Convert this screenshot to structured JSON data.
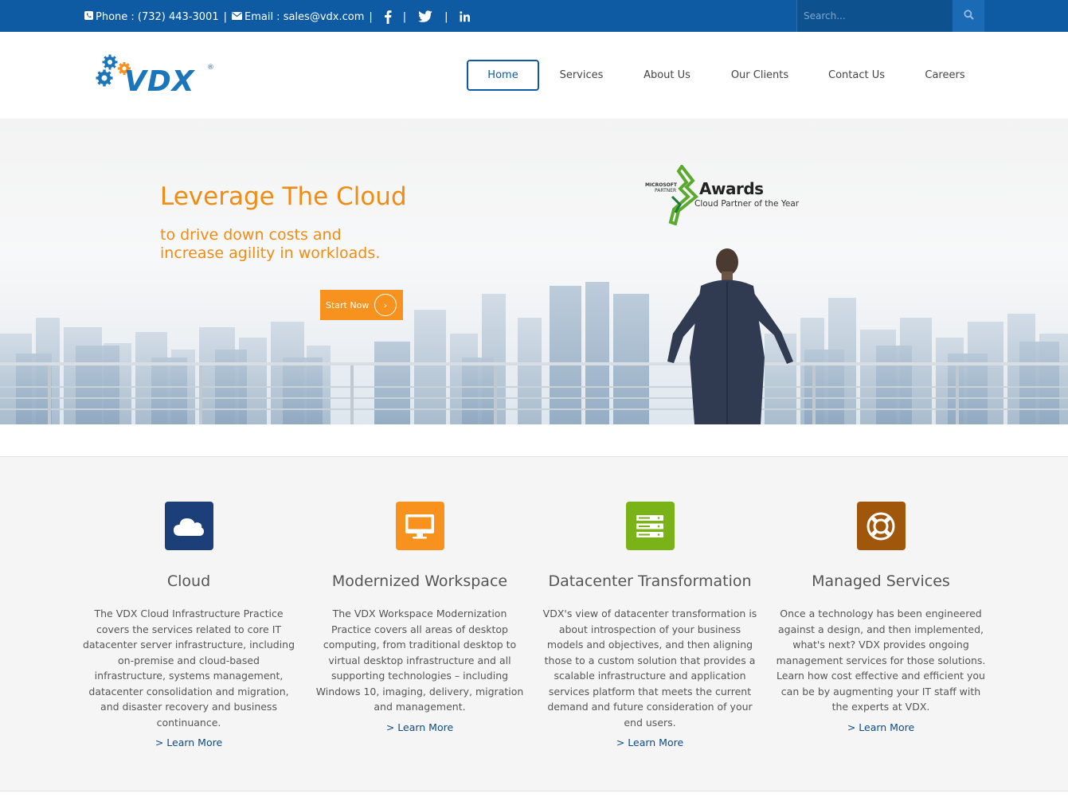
{
  "topbar": {
    "phone_label": "Phone : (732) 443-3001",
    "email_label": "Email : sales@vdx.com",
    "separator": "|",
    "search_placeholder": "Search...",
    "bg_color": "#0e5ba3"
  },
  "brand": {
    "name": "VDX",
    "registered": "®"
  },
  "nav": {
    "items": [
      {
        "label": "Home",
        "active": true
      },
      {
        "label": "Services"
      },
      {
        "label": "About Us"
      },
      {
        "label": "Our Clients"
      },
      {
        "label": "Contact Us"
      },
      {
        "label": "Careers"
      }
    ]
  },
  "hero": {
    "title": "Leverage The Cloud",
    "subtitle_line1": "to drive down costs and",
    "subtitle_line2": "increase agility in workloads.",
    "cta_label": "Start Now",
    "cta_arrow": "›",
    "award": {
      "brand_line1": "MICROSOFT",
      "brand_line2": "PARTNER",
      "title": "Awards",
      "subtitle": "Cloud Partner of the Year"
    },
    "accent_color": "#f08c14"
  },
  "features": [
    {
      "title": "Cloud",
      "icon": "cloud-icon",
      "color": "#1c3f7a",
      "text": "The VDX Cloud Infrastructure Practice covers the services related to core IT datacenter server infrastructure, including on-premise and cloud-based infrastructure, systems management, datacenter consolidation and migration, and disaster recovery and business continuance.",
      "link": "> Learn More"
    },
    {
      "title": "Modernized Workspace",
      "icon": "monitor-icon",
      "color": "#f7921e",
      "text": "The VDX Workspace Modernization Practice covers all areas of desktop computing, from traditional desktop to virtual desktop infrastructure and all supporting technologies – including Windows 10, imaging, delivery, migration and management.",
      "link": "> Learn More"
    },
    {
      "title": "Datacenter Transformation",
      "icon": "server-icon",
      "color": "#7ab317",
      "text": "VDX's view of datacenter transformation is about introspection of your business models and objectives, and then aligning those to a custom solution that provides a scalable infrastructure and application services platform that meets the current demand and future consideration of your end users.",
      "link": "> Learn More"
    },
    {
      "title": "Managed Services",
      "icon": "lifebuoy-icon",
      "color": "#a0560b",
      "text": "Once a technology has been engineered against a design, and then implemented, what's next? VDX provides ongoing management services for those solutions.  Learn how cost effective and efficient you can be by augmenting your IT staff with the experts at VDX.",
      "link": "> Learn More"
    }
  ]
}
